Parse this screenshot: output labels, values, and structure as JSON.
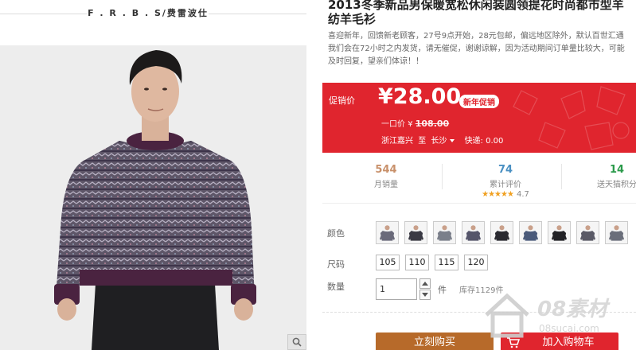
{
  "brand": {
    "text": "F . R . B . S/费雷波仕"
  },
  "product": {
    "title_line1": "2013冬季新品男保暖宽松休闲装圆领提花时尚都市型羊",
    "title_line2": "纺羊毛衫",
    "notice_lines": [
      "喜迎新年，回馈新老顾客，27号9点开始，28元包邮，偏远地区除外，默认百世汇通",
      "我们会在72小时之内发货，请无催促，谢谢谅解，因为活动期间订单量比较大，可能",
      "及时回复，望亲们体谅！！"
    ]
  },
  "promo": {
    "label": "促销价",
    "price": "¥28.00",
    "badge": "新年促销",
    "orig_label": "一口价",
    "orig_currency": "¥",
    "orig_price": "108.00",
    "ship_from": "浙江嘉兴",
    "ship_to_label": "至",
    "ship_to": "长沙",
    "express": "快递: 0.00",
    "color": "#e0252e"
  },
  "stats": {
    "monthly_sales": {
      "value": "544",
      "label": "月销量"
    },
    "reviews": {
      "value": "74",
      "label": "累计评价",
      "stars": "★★★★★",
      "score": "4.7"
    },
    "points": {
      "value": "14",
      "label": "送天猫积分"
    }
  },
  "options": {
    "color_label": "颜色",
    "color_count": 9,
    "size_label": "尺码",
    "sizes": [
      "105",
      "110",
      "115",
      "120"
    ],
    "qty_label": "数量",
    "qty_value": "1",
    "qty_unit": "件",
    "stock": "库存1129件"
  },
  "actions": {
    "buy_now": "立刻购买",
    "add_cart": "加入购物车"
  },
  "watermark": {
    "text": "08素材",
    "sub": "08sucai.com"
  }
}
